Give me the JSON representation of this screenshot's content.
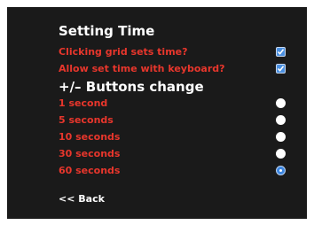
{
  "title": "Setting Time",
  "options": [
    {
      "label": "Clicking grid sets time?",
      "checked": true
    },
    {
      "label": "Allow set time with keyboard?",
      "checked": true
    }
  ],
  "buttons_heading": "+/– Buttons change",
  "intervals": [
    {
      "label": "1 second",
      "selected": false
    },
    {
      "label": "5 seconds",
      "selected": false
    },
    {
      "label": "10 seconds",
      "selected": false
    },
    {
      "label": "30 seconds",
      "selected": false
    },
    {
      "label": "60 seconds",
      "selected": true
    }
  ],
  "back_label": "<< Back",
  "colors": {
    "background": "#1a1a1a",
    "label_red": "#e8362c",
    "heading_white": "#ffffff",
    "accent_blue": "#3d86e0"
  }
}
